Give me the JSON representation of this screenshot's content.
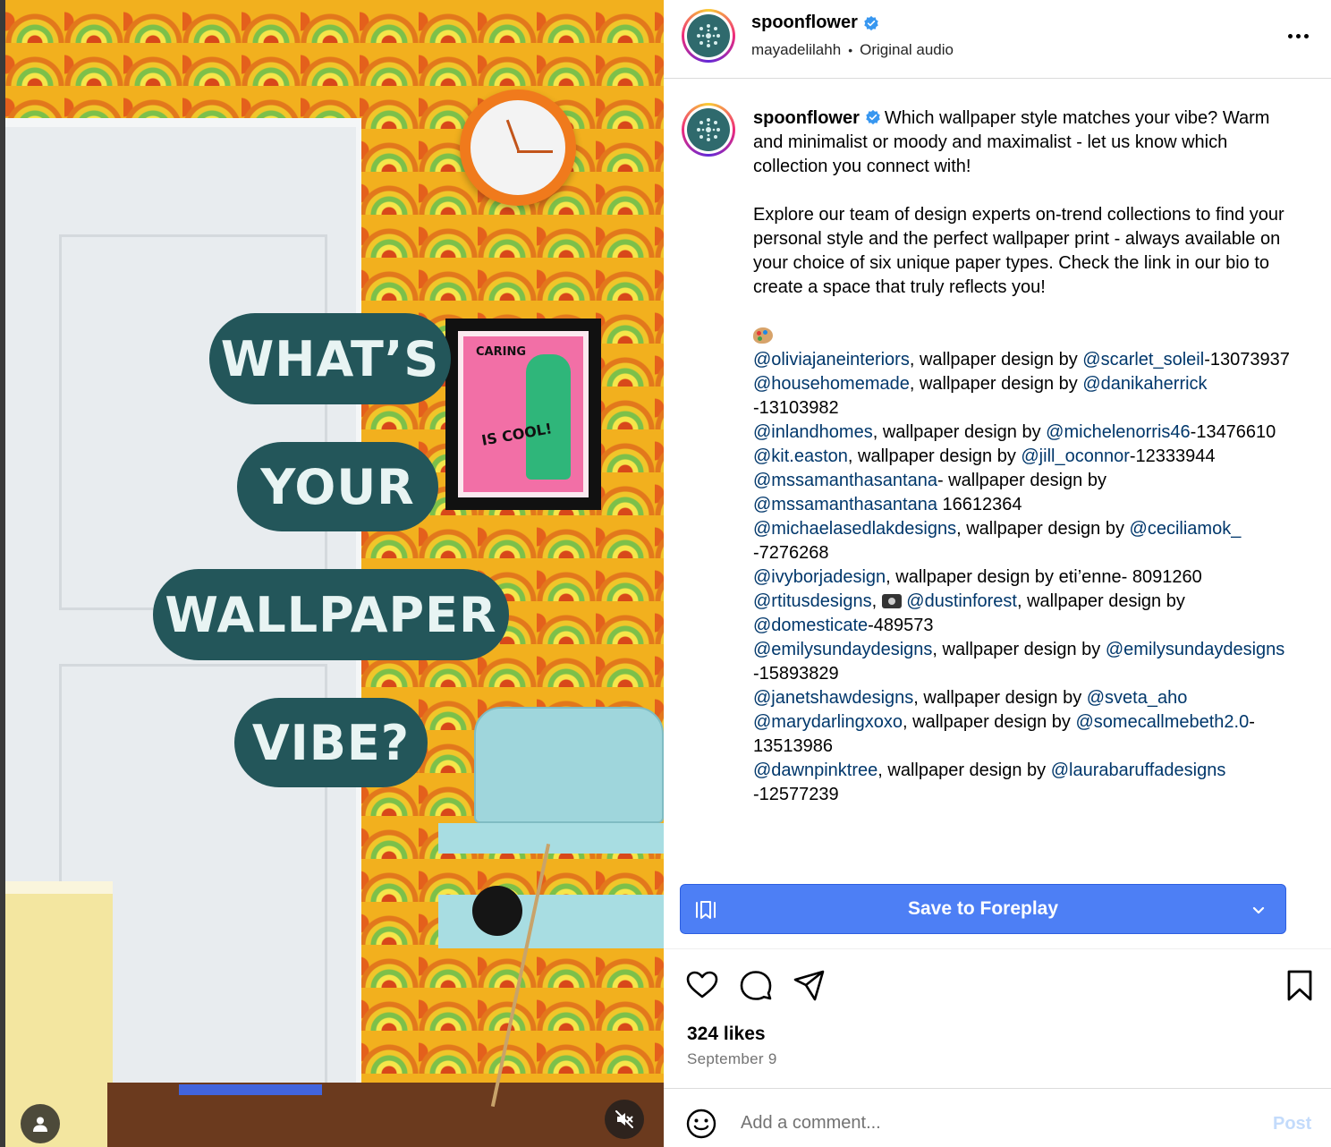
{
  "media": {
    "overlay_lines": [
      "WHAT’S",
      "YOUR",
      "WALLPAPER",
      "VIBE?"
    ],
    "art_print_text": [
      "CARING",
      "IS COOL!"
    ],
    "profile_button_icon": "person-icon",
    "mute_button_icon": "speaker-muted-icon"
  },
  "header": {
    "username": "spoonflower",
    "verified": true,
    "audio_user": "mayadelilahh",
    "audio_separator": "•",
    "audio_label": "Original audio",
    "more_icon": "more-horizontal-icon"
  },
  "caption": {
    "username": "spoonflower",
    "paragraphs": [
      "Which wallpaper style matches your vibe? Warm and minimalist or moody and maximalist - let us know which collection you connect with!",
      "Explore our team of design experts on-trend collections to find your personal style and the perfect wallpaper print - always available on your choice of six unique paper types. Check the link in our bio to create a space that truly reflects you!"
    ],
    "credits": [
      [
        {
          "m": "@oliviajaneinteriors"
        },
        {
          "t": ", wallpaper design by "
        },
        {
          "m": "@scarlet_soleil"
        },
        {
          "t": "-13073937"
        }
      ],
      [
        {
          "m": "@househomemade"
        },
        {
          "t": ", wallpaper design by "
        },
        {
          "m": "@danikaherrick"
        },
        {
          "t": " -13103982"
        }
      ],
      [
        {
          "m": "@inlandhomes"
        },
        {
          "t": ", wallpaper design by "
        },
        {
          "m": "@michelenorris46"
        },
        {
          "t": "-13476610"
        }
      ],
      [
        {
          "m": "@kit.easton"
        },
        {
          "t": ", wallpaper design by "
        },
        {
          "m": "@jill_oconnor"
        },
        {
          "t": "-12333944"
        }
      ],
      [
        {
          "m": "@mssamanthasantana"
        },
        {
          "t": "- wallpaper design by "
        },
        {
          "m": "@mssamanthasantana"
        },
        {
          "t": " 16612364"
        }
      ],
      [
        {
          "m": "@michaelasedlakdesigns"
        },
        {
          "t": ", wallpaper design by "
        },
        {
          "m": "@ceciliamok_"
        },
        {
          "t": " -7276268"
        }
      ],
      [
        {
          "m": "@ivyborjadesign"
        },
        {
          "t": ", wallpaper design by eti’enne- 8091260"
        }
      ],
      [
        {
          "m": "@rtitusdesigns"
        },
        {
          "t": ", "
        },
        {
          "cam": true
        },
        {
          "t": " "
        },
        {
          "m": "@dustinforest"
        },
        {
          "t": ", wallpaper design by "
        },
        {
          "m": "@domesticate"
        },
        {
          "t": "-489573"
        }
      ],
      [
        {
          "m": "@emilysundaydesigns"
        },
        {
          "t": ", wallpaper design by "
        },
        {
          "m": "@emilysundaydesigns"
        },
        {
          "t": " -15893829"
        }
      ],
      [
        {
          "m": "@janetshawdesigns"
        },
        {
          "t": ", wallpaper design by "
        },
        {
          "m": "@sveta_aho"
        }
      ],
      [
        {
          "m": "@marydarlingxoxo"
        },
        {
          "t": ", wallpaper design by "
        },
        {
          "m": "@somecallmebeth2.0"
        },
        {
          "t": "-13513986"
        }
      ],
      [
        {
          "m": "@dawnpinktree"
        },
        {
          "t": ", wallpaper design by "
        },
        {
          "m": "@laurabaruffadesigns"
        },
        {
          "t": " -12577239"
        }
      ]
    ]
  },
  "save_bar": {
    "label": "Save to Foreplay",
    "icon": "foreplay-save-icon",
    "chevron_icon": "chevron-down-icon",
    "color": "#4d7ff5"
  },
  "actions": {
    "like_icon": "heart-icon",
    "comment_icon": "comment-icon",
    "share_icon": "send-icon",
    "bookmark_icon": "bookmark-icon"
  },
  "stats": {
    "likes": "324 likes",
    "date": "September 9"
  },
  "comment_box": {
    "placeholder": "Add a comment...",
    "post_label": "Post",
    "emoji_icon": "emoji-icon"
  },
  "colors": {
    "mention": "#00376b",
    "overlay_pill": "#23565a",
    "post_disabled": "#c3dbfb"
  }
}
